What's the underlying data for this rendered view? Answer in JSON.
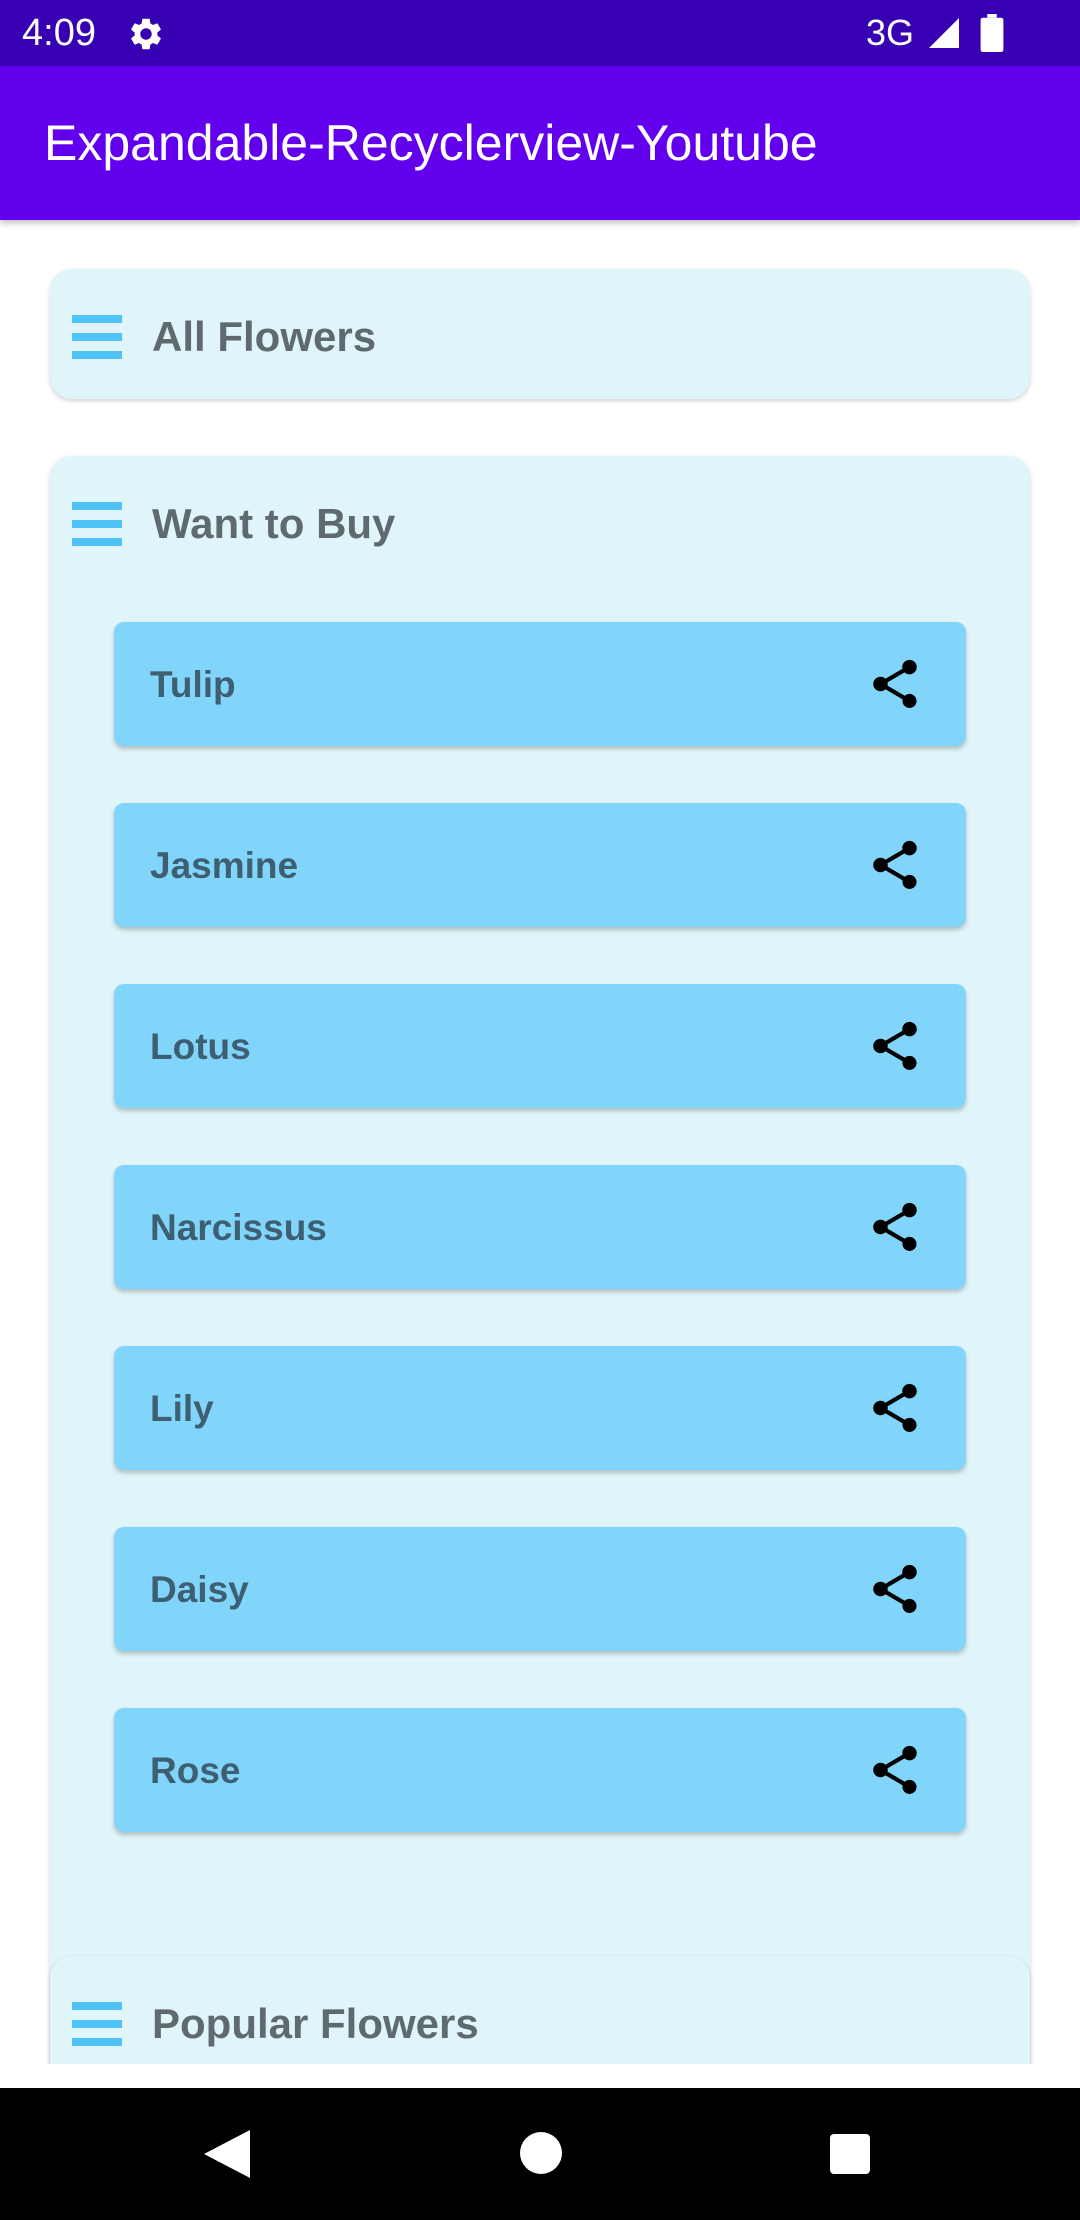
{
  "status_bar": {
    "time": "4:09",
    "network": "3G",
    "icons": [
      "settings-gear-icon",
      "signal-icon",
      "battery-icon"
    ]
  },
  "app_bar": {
    "title": "Expandable-Recyclerview-Youtube",
    "color": "#6200ee"
  },
  "groups": [
    {
      "title": "All Flowers",
      "expanded": false,
      "icon": "menu-icon",
      "children": []
    },
    {
      "title": "Want to Buy",
      "expanded": true,
      "icon": "menu-icon",
      "children": [
        {
          "label": "Tulip",
          "icon": "share-icon"
        },
        {
          "label": "Jasmine",
          "icon": "share-icon"
        },
        {
          "label": "Lotus",
          "icon": "share-icon"
        },
        {
          "label": "Narcissus",
          "icon": "share-icon"
        },
        {
          "label": "Lily",
          "icon": "share-icon"
        },
        {
          "label": "Daisy",
          "icon": "share-icon"
        },
        {
          "label": "Rose",
          "icon": "share-icon"
        }
      ]
    },
    {
      "title": "Popular Flowers",
      "expanded": false,
      "icon": "menu-icon",
      "children": []
    }
  ],
  "navigation_bar": {
    "buttons": [
      "back-icon",
      "home-icon",
      "recents-icon"
    ]
  },
  "colors": {
    "status_bar": "#3700b3",
    "app_bar": "#6200ee",
    "group_card": "#e0f5f9",
    "child_card": "#81d4fa",
    "menu_icon": "#4fc3f7",
    "group_text": "#5f6a70",
    "child_text": "#3e5f72"
  }
}
